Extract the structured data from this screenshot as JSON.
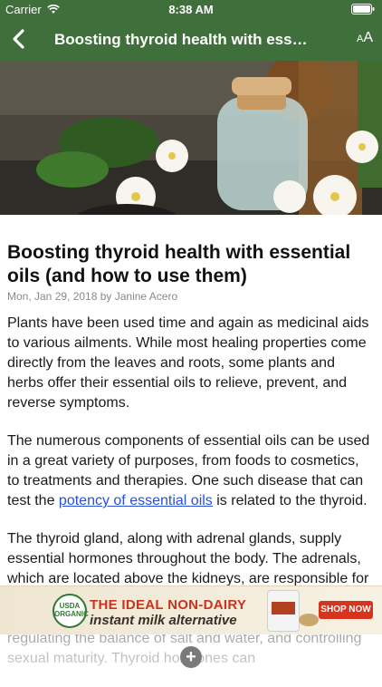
{
  "status_bar": {
    "carrier": "Carrier",
    "time": "8:38 AM"
  },
  "nav": {
    "title": "Boosting thyroid health with ess…",
    "font_size_label": "A",
    "font_size_label_large": "A"
  },
  "article": {
    "headline": "Boosting thyroid health with essential oils (and how to use them)",
    "byline": "Mon, Jan 29, 2018 by Janine Acero",
    "p1": "Plants have been used time and again as medicinal aids to various ailments. While most healing properties come directly from the leaves and roots, some plants and herbs offer their essential oils to relieve, prevent, and reverse symptoms.",
    "p2_before": "The numerous components of essential oils can be used in a great variety of purposes, from foods to cosmetics, to treatments and therapies. One such disease that can test the ",
    "p2_link": "potency of essential oils",
    "p2_after": " is related to the thyroid.",
    "p3": "The thyroid gland, along with adrenal glands, supply essential hormones throughout the body. The adrenals, which are located above the kidneys, are responsible for producing the stress hormones like cortisol. They are also responsible for managing blood sugar levels, regulating the balance of salt and water, and controlling sexual maturity. Thyroid hormones can"
  },
  "ad": {
    "headline": "THE IDEAL NON-DAIRY",
    "subline": "instant milk alternative",
    "badge": "USDA ORGANIC",
    "cta": "SHOP NOW"
  },
  "fab": {
    "icon": "plus-icon"
  },
  "colors": {
    "nav_bg": "#3f6f3a",
    "link": "#2a50d6",
    "ad_cta": "#d8331d"
  }
}
